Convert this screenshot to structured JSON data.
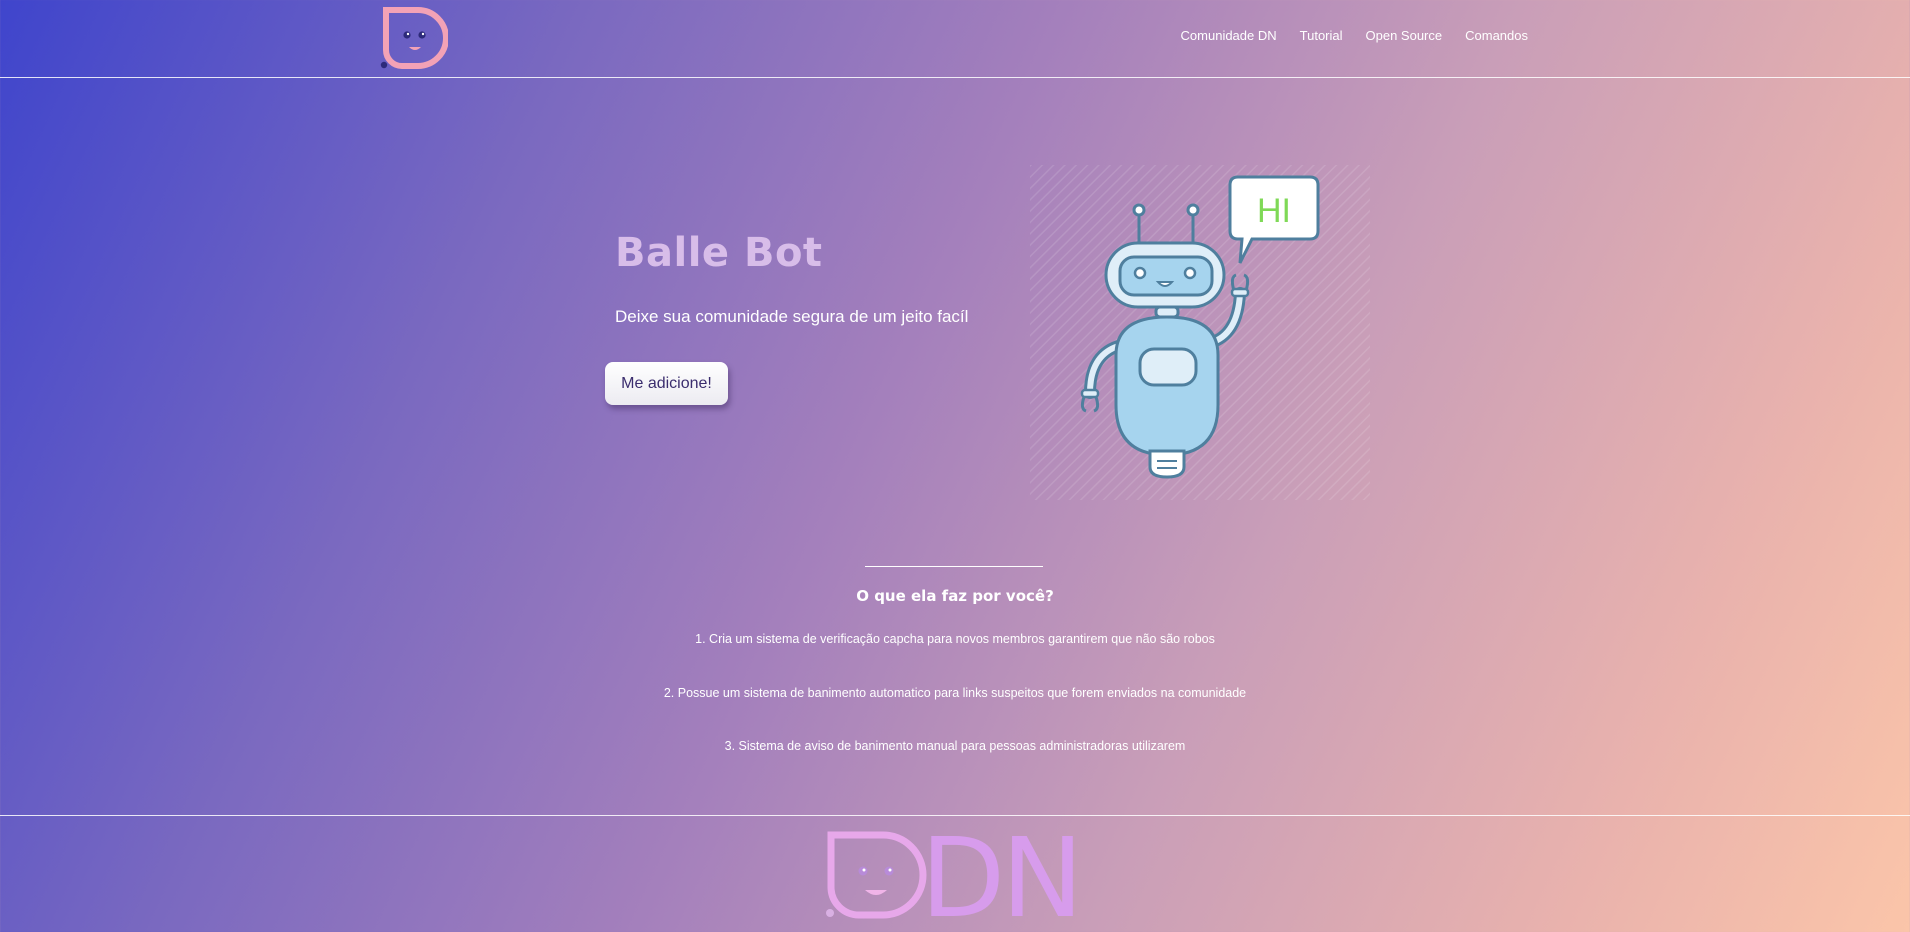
{
  "header": {
    "logo_icon": "dn-face-logo-icon",
    "nav": [
      "Comunidade DN",
      "Tutorial",
      "Open Source",
      "Comandos"
    ]
  },
  "hero": {
    "title": "Balle Bot",
    "subtitle": "Deixe sua comunidade segura de um jeito facíl",
    "button_label": "Me adicione!",
    "illustration": "robot-waving-icon",
    "speech_bubble_text": "HI"
  },
  "features": {
    "title": "O que ela faz por você?",
    "items": [
      "1. Cria um sistema de verificação capcha para novos membros garantirem que não são robos",
      "2. Possue um sistema de banimento automatico para links suspeitos que forem enviados na comunidade",
      "3. Sistema de aviso de banimento manual para pessoas administradoras utilizarem"
    ]
  },
  "footer": {
    "logo_text": "DN",
    "logo_icon": "dn-face-logo-icon"
  },
  "colors": {
    "gradient_start": "#3f45cc",
    "gradient_end": "#fbc5a9",
    "title_color": "#d8bde9",
    "logo_pink": "#f3a2b6",
    "button_text": "#3b2d6e"
  }
}
